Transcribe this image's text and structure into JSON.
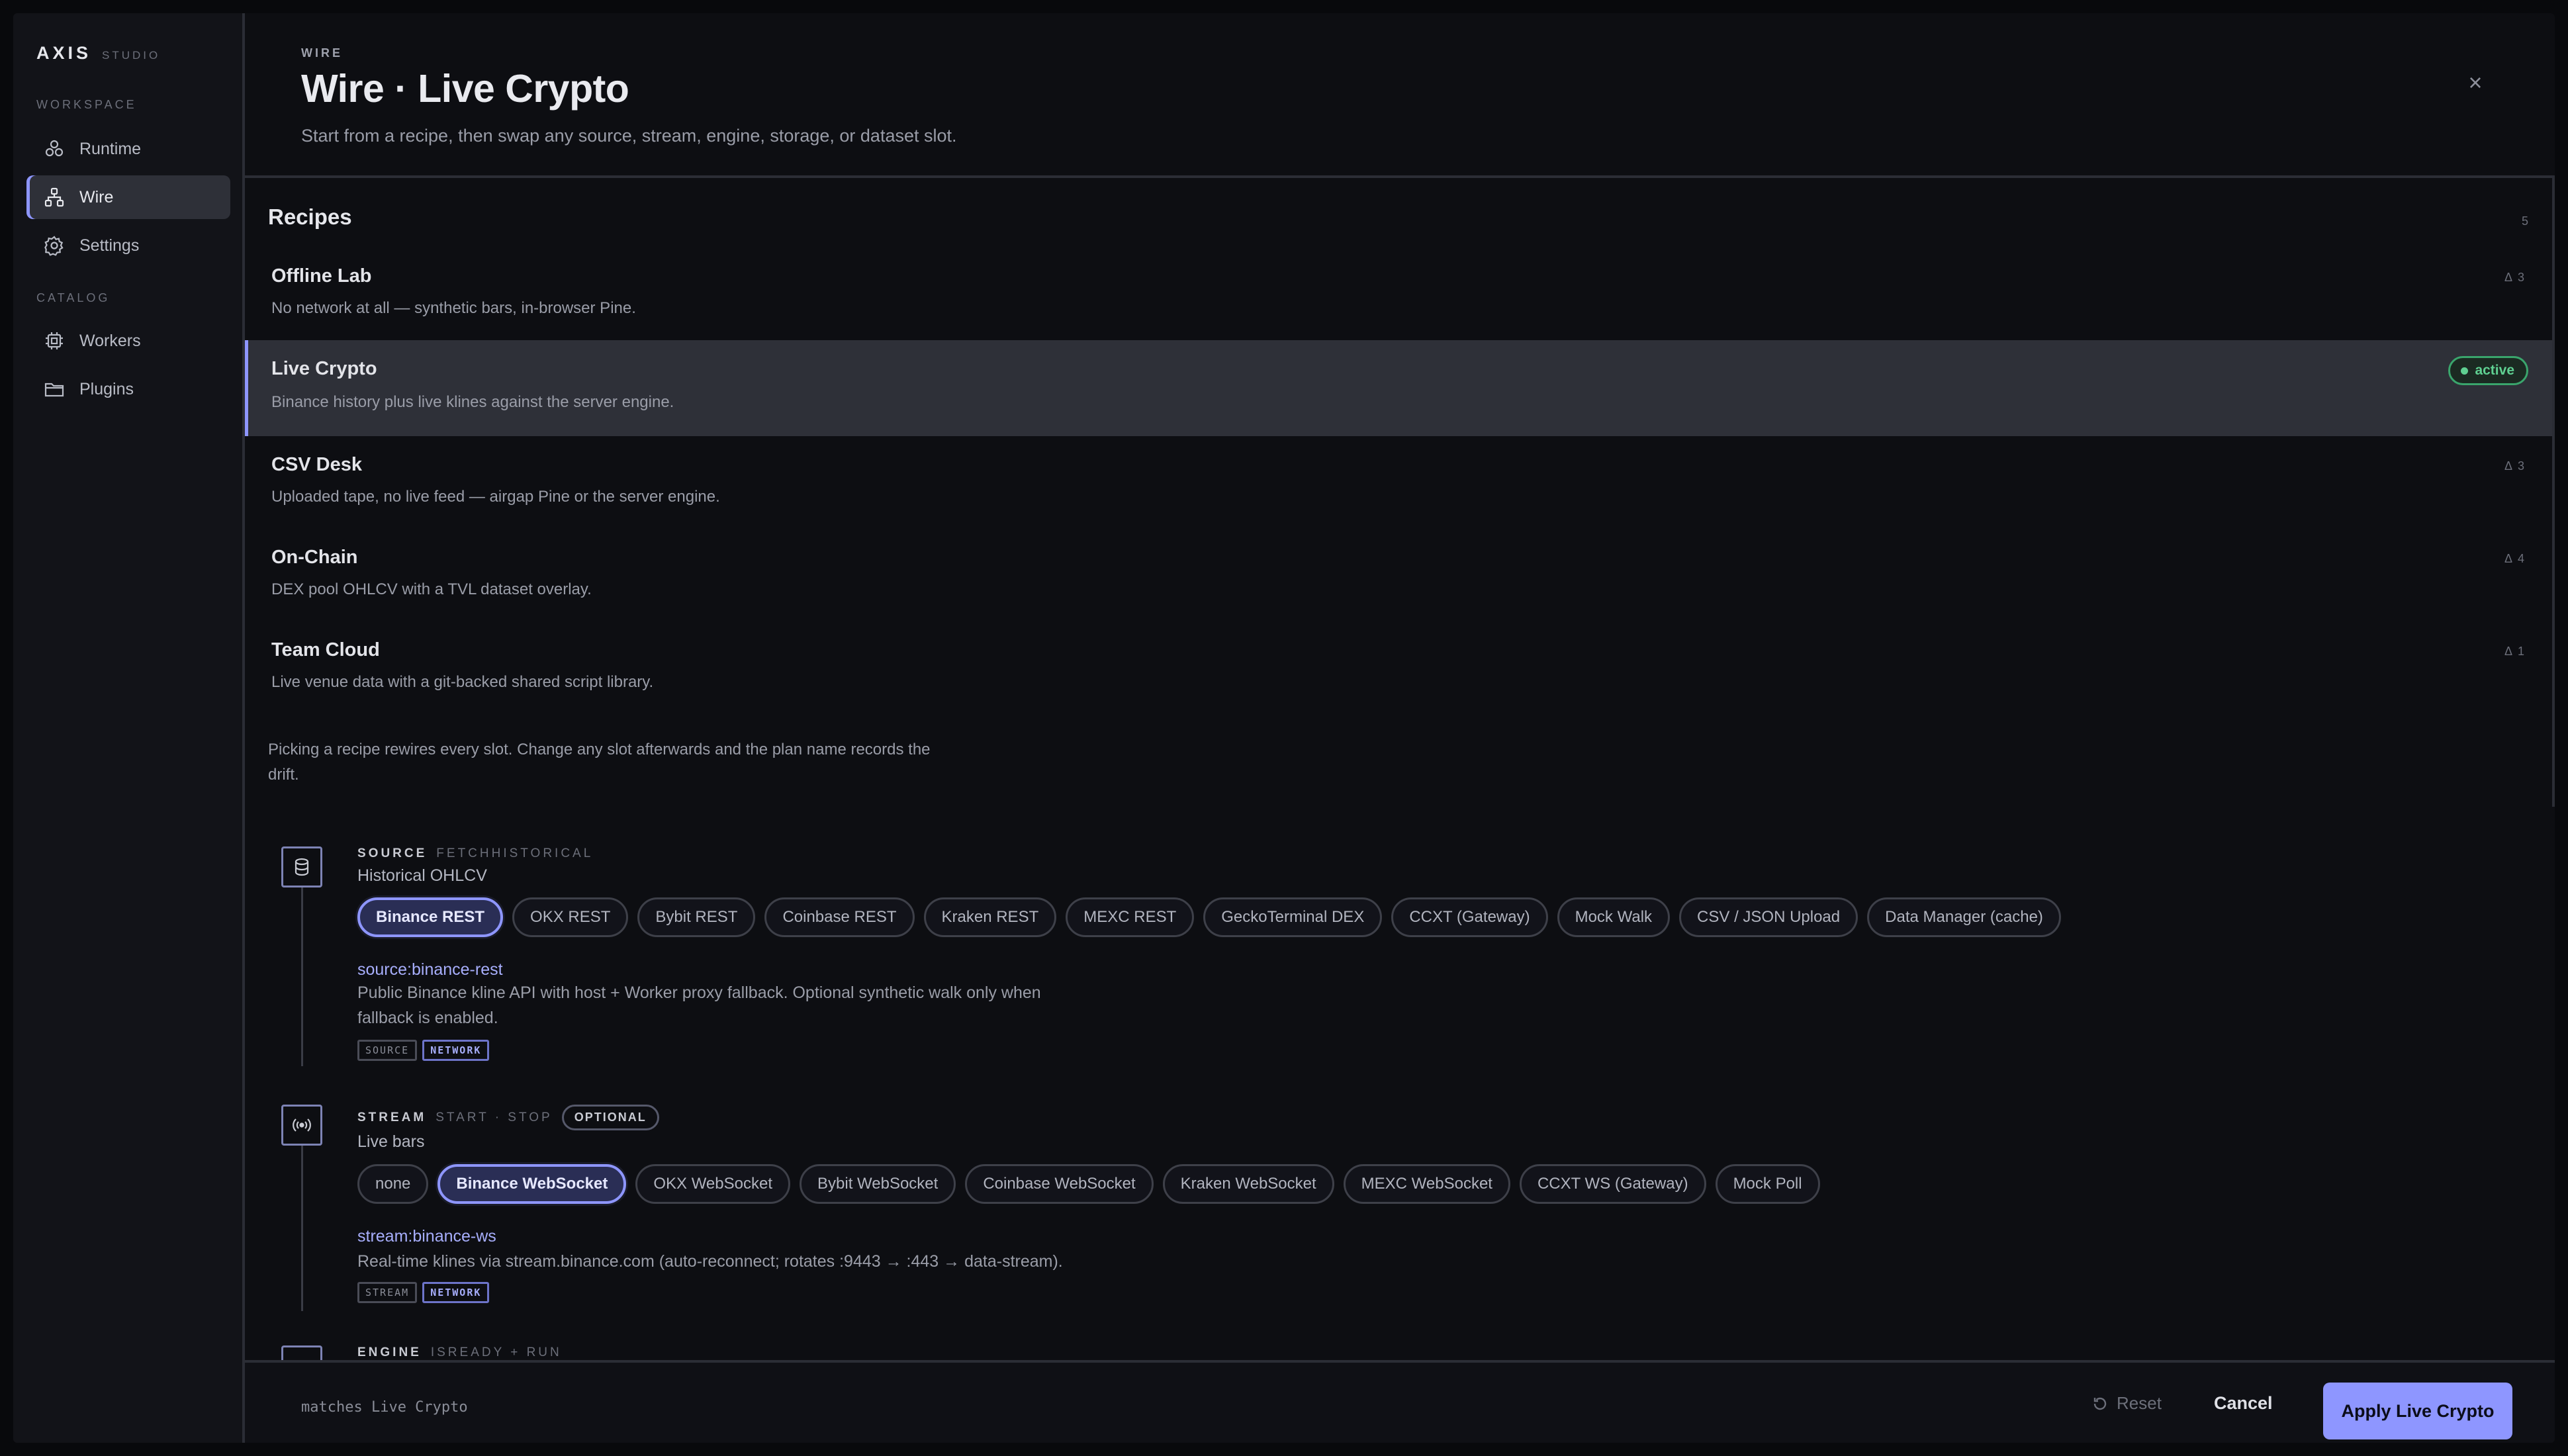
{
  "sidebar": {
    "brand": "AXIS",
    "brand_sub": "STUDIO",
    "workspace_label": "WORKSPACE",
    "catalog_label": "CATALOG",
    "items": [
      {
        "label": "Runtime",
        "icon": "runtime-icon"
      },
      {
        "label": "Wire",
        "icon": "wire-icon",
        "active": true
      },
      {
        "label": "Settings",
        "icon": "gear-icon"
      },
      {
        "label": "Workers",
        "icon": "cpu-icon"
      },
      {
        "label": "Plugins",
        "icon": "folder-icon"
      }
    ]
  },
  "header": {
    "kicker": "WIRE",
    "title": "Wire · Live Crypto",
    "subtitle": "Start from a recipe, then swap any source, stream, engine, storage, or dataset slot.",
    "close": "×"
  },
  "recipes": {
    "title": "Recipes",
    "count": "5",
    "items": [
      {
        "name": "Offline Lab",
        "desc": "No network at all — synthetic bars, in-browser Pine.",
        "delta": "Δ 3"
      },
      {
        "name": "Live Crypto",
        "desc": "Binance history plus live klines against the server engine.",
        "badge": "active"
      },
      {
        "name": "CSV Desk",
        "desc": "Uploaded tape, no live feed — airgap Pine or the server engine.",
        "delta": "Δ 3"
      },
      {
        "name": "On-Chain",
        "desc": "DEX pool OHLCV with a TVL dataset overlay.",
        "delta": "Δ 4"
      },
      {
        "name": "Team Cloud",
        "desc": "Live venue data with a git-backed shared script library.",
        "delta": "Δ 1"
      }
    ],
    "note": "Picking a recipe rewires every slot. Change any slot afterwards and the plan name records the drift."
  },
  "slots": {
    "source": {
      "kind": "SOURCE",
      "sub": "FETCHHISTORICAL",
      "label": "Historical OHLCV",
      "options": [
        "Binance REST",
        "OKX REST",
        "Bybit REST",
        "Coinbase REST",
        "Kraken REST",
        "MEXC REST",
        "GeckoTerminal DEX",
        "CCXT (Gateway)",
        "Mock Walk",
        "CSV / JSON Upload",
        "Data Manager (cache)"
      ],
      "selected": "Binance REST",
      "id": "source:binance-rest",
      "desc": "Public Binance kline API with host + Worker proxy fallback. Optional synthetic walk only when fallback is enabled.",
      "tags": [
        "SOURCE",
        "NETWORK"
      ]
    },
    "stream": {
      "kind": "STREAM",
      "sub": "START · STOP",
      "optional": "OPTIONAL",
      "label": "Live bars",
      "options": [
        "none",
        "Binance WebSocket",
        "OKX WebSocket",
        "Bybit WebSocket",
        "Coinbase WebSocket",
        "Kraken WebSocket",
        "MEXC WebSocket",
        "CCXT WS (Gateway)",
        "Mock Poll"
      ],
      "selected": "Binance WebSocket",
      "id": "stream:binance-ws",
      "desc": "Real-time klines via stream.binance.com (auto-reconnect; rotates :9443 → :443 → data-stream).",
      "tags": [
        "STREAM",
        "NETWORK"
      ]
    },
    "engine": {
      "kind": "ENGINE",
      "sub": "ISREADY + RUN"
    }
  },
  "footer": {
    "status": "matches Live Crypto",
    "reset": "Reset",
    "cancel": "Cancel",
    "apply": "Apply Live Crypto"
  },
  "colors": {
    "accent": "#8e96ff",
    "active_green": "#5fd091",
    "background": "#0d0e12",
    "sidebar": "#121318"
  }
}
